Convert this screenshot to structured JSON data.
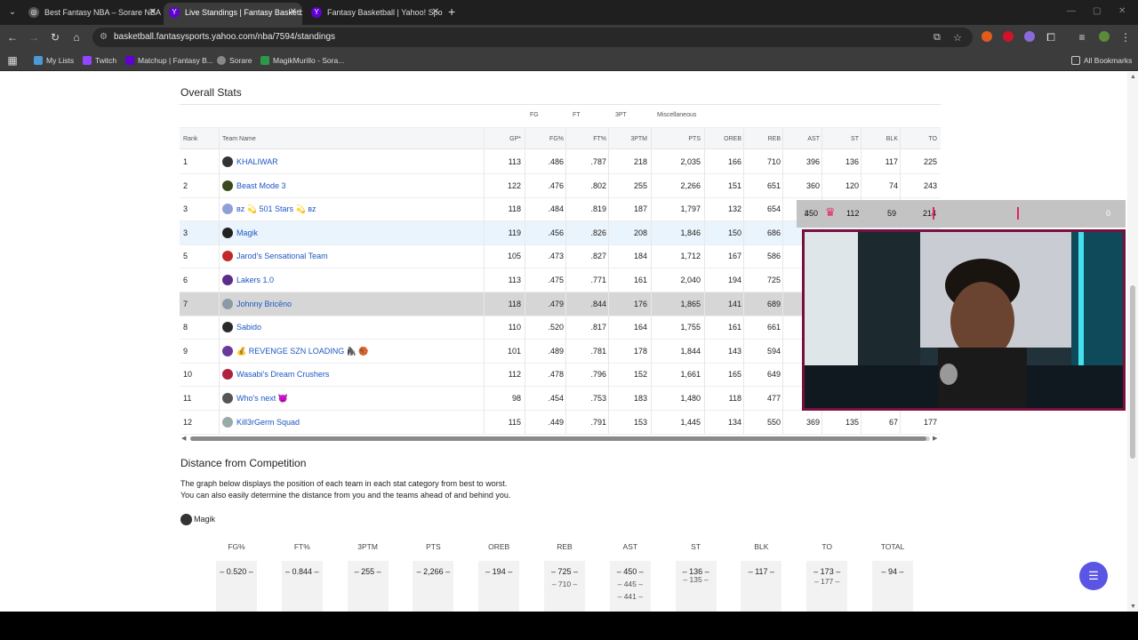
{
  "browser": {
    "tabs": [
      {
        "title": "Best Fantasy NBA – Sorare NBA",
        "active": false
      },
      {
        "title": "Live Standings | Fantasy Basketb",
        "active": true
      },
      {
        "title": "Fantasy Basketball | Yahoo! Spo",
        "active": false
      }
    ],
    "url": "basketball.fantasysports.yahoo.com/nba/7594/standings",
    "bookmarks": [
      "My Lists",
      "Twitch",
      "Matchup | Fantasy B...",
      "Sorare",
      "MagikMurillo - Sora..."
    ],
    "all_bookmarks": "All Bookmarks"
  },
  "overall_stats": {
    "title": "Overall Stats",
    "groups": [
      "FG",
      "FT",
      "3PT",
      "Miscellaneous"
    ],
    "columns": [
      "Rank",
      "Team Name",
      "GP*",
      "FG%",
      "FT%",
      "3PTM",
      "PTS",
      "OREB",
      "REB",
      "AST",
      "ST",
      "BLK",
      "TO"
    ],
    "rows": [
      {
        "rank": "1",
        "team": "KHALIWAR",
        "gp": "113",
        "fg": ".486",
        "ft": ".787",
        "tpm": "218",
        "pts": "2,035",
        "oreb": "166",
        "reb": "710",
        "ast": "396",
        "st": "136",
        "blk": "117",
        "to": "225",
        "logo": "#333"
      },
      {
        "rank": "2",
        "team": "Beast Mode 3",
        "gp": "122",
        "fg": ".476",
        "ft": ".802",
        "tpm": "255",
        "pts": "2,266",
        "oreb": "151",
        "reb": "651",
        "ast": "360",
        "st": "120",
        "blk": "74",
        "to": "243",
        "logo": "#3a4a1a"
      },
      {
        "rank": "3",
        "team": "ʙᴢ 💫 501 Stars 💫 ʙᴢ",
        "gp": "118",
        "fg": ".484",
        "ft": ".819",
        "tpm": "187",
        "pts": "1,797",
        "oreb": "132",
        "reb": "654",
        "ast": "",
        "st": "",
        "blk": "",
        "to": "",
        "logo": "#8fa0d8"
      },
      {
        "rank": "3",
        "team": "Magik",
        "gp": "119",
        "fg": ".456",
        "ft": ".826",
        "tpm": "208",
        "pts": "1,846",
        "oreb": "150",
        "reb": "686",
        "ast": "",
        "st": "",
        "blk": "",
        "to": "",
        "logo": "#222"
      },
      {
        "rank": "5",
        "team": "Jarod's Sensational Team",
        "gp": "105",
        "fg": ".473",
        "ft": ".827",
        "tpm": "184",
        "pts": "1,712",
        "oreb": "167",
        "reb": "586",
        "ast": "",
        "st": "",
        "blk": "",
        "to": "",
        "logo": "#c0282a"
      },
      {
        "rank": "6",
        "team": "Lakers 1.0",
        "gp": "113",
        "fg": ".475",
        "ft": ".771",
        "tpm": "161",
        "pts": "2,040",
        "oreb": "194",
        "reb": "725",
        "ast": "",
        "st": "",
        "blk": "",
        "to": "",
        "logo": "#5a2e8a"
      },
      {
        "rank": "7",
        "team": "Johnny Bricēno",
        "gp": "118",
        "fg": ".479",
        "ft": ".844",
        "tpm": "176",
        "pts": "1,865",
        "oreb": "141",
        "reb": "689",
        "ast": "",
        "st": "",
        "blk": "",
        "to": "",
        "logo": "#8a9aa8"
      },
      {
        "rank": "8",
        "team": "Sabido",
        "gp": "110",
        "fg": ".520",
        "ft": ".817",
        "tpm": "164",
        "pts": "1,755",
        "oreb": "161",
        "reb": "661",
        "ast": "",
        "st": "",
        "blk": "",
        "to": "",
        "logo": "#2a2a2a"
      },
      {
        "rank": "9",
        "team": "💰 REVENGE SZN LOADING 🦍 🏀",
        "gp": "101",
        "fg": ".489",
        "ft": ".781",
        "tpm": "178",
        "pts": "1,844",
        "oreb": "143",
        "reb": "594",
        "ast": "",
        "st": "",
        "blk": "",
        "to": "",
        "logo": "#6a3a9a"
      },
      {
        "rank": "10",
        "team": "Wasabi's Dream Crushers",
        "gp": "112",
        "fg": ".478",
        "ft": ".796",
        "tpm": "152",
        "pts": "1,661",
        "oreb": "165",
        "reb": "649",
        "ast": "",
        "st": "",
        "blk": "",
        "to": "",
        "logo": "#b02040"
      },
      {
        "rank": "11",
        "team": "Who's next 😈",
        "gp": "98",
        "fg": ".454",
        "ft": ".753",
        "tpm": "183",
        "pts": "1,480",
        "oreb": "118",
        "reb": "477",
        "ast": "",
        "st": "",
        "blk": "",
        "to": "",
        "logo": "#555"
      },
      {
        "rank": "12",
        "team": "Kill3rGerm Squad",
        "gp": "115",
        "fg": ".449",
        "ft": ".791",
        "tpm": "153",
        "pts": "1,445",
        "oreb": "134",
        "reb": "550",
        "ast": "369",
        "st": "135",
        "blk": "67",
        "to": "177",
        "logo": "#9aa"
      }
    ]
  },
  "overlay_row3": {
    "ast": "450",
    "st": "112",
    "blk": "59",
    "to": "214",
    "left_num": "1",
    "right_num": "0"
  },
  "distance": {
    "title": "Distance from Competition",
    "desc1": "The graph below displays the position of each team in each stat category from best to worst.",
    "desc2": "You can also easily determine the distance from you and the teams ahead of and behind you.",
    "team": "Magik",
    "columns": [
      {
        "label": "FG%",
        "vals": [
          "0.520"
        ]
      },
      {
        "label": "FT%",
        "vals": [
          "0.844"
        ]
      },
      {
        "label": "3PTM",
        "vals": [
          "255"
        ]
      },
      {
        "label": "PTS",
        "vals": [
          "2,266"
        ]
      },
      {
        "label": "OREB",
        "vals": [
          "194"
        ]
      },
      {
        "label": "REB",
        "vals": [
          "725",
          "710"
        ]
      },
      {
        "label": "AST",
        "vals": [
          "450",
          "445",
          "441"
        ]
      },
      {
        "label": "ST",
        "vals": [
          "136",
          "135"
        ]
      },
      {
        "label": "BLK",
        "vals": [
          "117"
        ]
      },
      {
        "label": "TO",
        "vals": [
          "173",
          "177"
        ]
      },
      {
        "label": "TOTAL",
        "vals": [
          "94"
        ]
      }
    ]
  },
  "colors": {
    "link": "#1d57c3",
    "accent": "#5b55e6",
    "webcam_border": "#7b0f3c"
  }
}
